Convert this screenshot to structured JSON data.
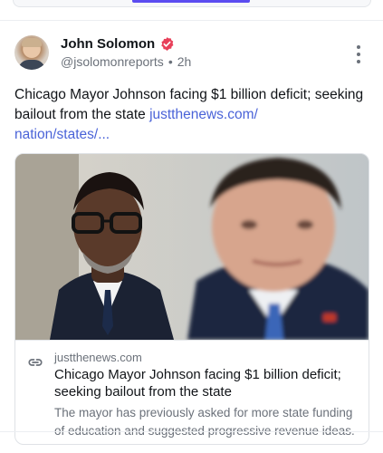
{
  "post": {
    "author_name": "John Solomon",
    "handle": "@jsolomonreports",
    "time": "2h",
    "text": "Chicago Mayor Johnson facing $1 billion deficit; seeking bailout from the state ",
    "link_text_line1": "justthenews.com/",
    "link_text_line2": "nation/states/...",
    "icons": {
      "verified": "verified-badge-icon",
      "more": "more-vertical-icon",
      "link": "link-icon"
    }
  },
  "card": {
    "domain": "justthenews.com",
    "title": "Chicago Mayor Johnson facing $1 billion deficit; seeking bailout from the state",
    "description": "The mayor has previously asked for more state funding of education and suggested progressive revenue ideas."
  },
  "colors": {
    "link": "#4a63d8",
    "verified": "#e8405a",
    "tab_indicator": "#5b4cf0"
  }
}
